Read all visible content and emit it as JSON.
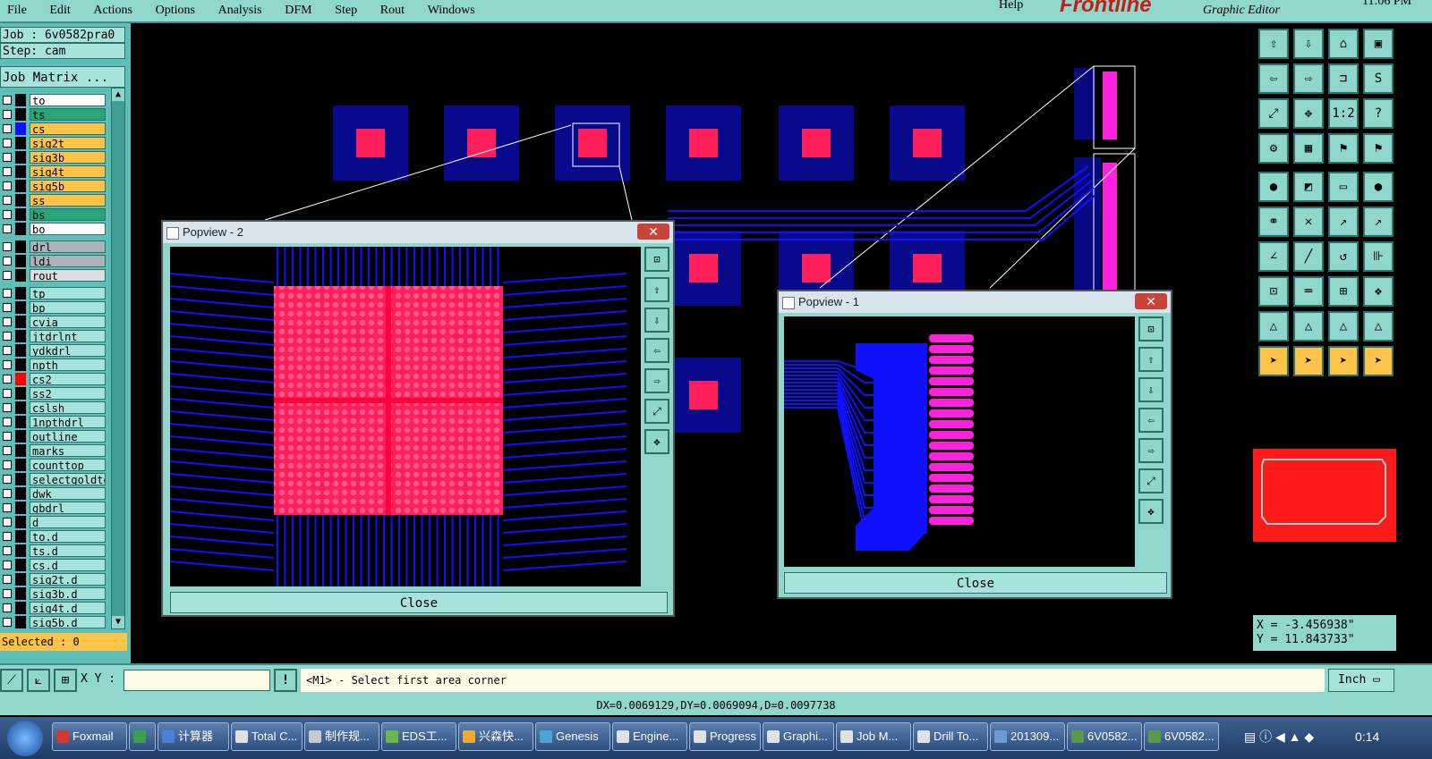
{
  "menubar": {
    "items": [
      "File",
      "Edit",
      "Actions",
      "Options",
      "Analysis",
      "DFM",
      "Step",
      "Rout",
      "Windows"
    ],
    "help": "Help"
  },
  "brand": {
    "logo": "Frontline",
    "subtitle": "Graphic Editor",
    "time": "11:06 PM"
  },
  "job": {
    "job": "Job : 6v0582pra0",
    "step": "Step: cam",
    "matrix_button": "Job Matrix ..."
  },
  "layers": [
    {
      "name": "to",
      "bg": "#ffffff",
      "sw": "#000000"
    },
    {
      "name": "ts",
      "bg": "#2aa579",
      "sw": "#000000"
    },
    {
      "name": "cs",
      "bg": "#ffc34a",
      "sw": "#1010ff"
    },
    {
      "name": "sig2t",
      "bg": "#ffc34a",
      "sw": "#000000"
    },
    {
      "name": "sig3b",
      "bg": "#ffc34a",
      "sw": "#000000"
    },
    {
      "name": "sig4t",
      "bg": "#ffc34a",
      "sw": "#000000"
    },
    {
      "name": "sig5b",
      "bg": "#ffc34a",
      "sw": "#000000"
    },
    {
      "name": "ss",
      "bg": "#ffc34a",
      "sw": "#000000"
    },
    {
      "name": "bs",
      "bg": "#2aa579",
      "sw": "#000000"
    },
    {
      "name": "bo",
      "bg": "#ffffff",
      "sw": "#000000"
    },
    {
      "name": "drl",
      "bg": "#a9b4b8",
      "sw": "#000000",
      "gap": true
    },
    {
      "name": "ldi",
      "bg": "#a9b4b8",
      "sw": "#000000"
    },
    {
      "name": "rout",
      "bg": "#d9dedf",
      "sw": "#000000"
    },
    {
      "name": "tp",
      "bg": "#a6e3dc",
      "sw": "#000000",
      "gap": true
    },
    {
      "name": "bp",
      "bg": "#a6e3dc",
      "sw": "#000000"
    },
    {
      "name": "cvia",
      "bg": "#a6e3dc",
      "sw": "#000000"
    },
    {
      "name": "jtdrlnt",
      "bg": "#a6e3dc",
      "sw": "#000000"
    },
    {
      "name": "ydkdrl",
      "bg": "#a6e3dc",
      "sw": "#000000"
    },
    {
      "name": "npth",
      "bg": "#a6e3dc",
      "sw": "#000000"
    },
    {
      "name": "cs2",
      "bg": "#a6e3dc",
      "sw": "#ff0000"
    },
    {
      "name": "ss2",
      "bg": "#a6e3dc",
      "sw": "#000000"
    },
    {
      "name": "cslsh",
      "bg": "#a6e3dc",
      "sw": "#000000"
    },
    {
      "name": "1npthdrl",
      "bg": "#a6e3dc",
      "sw": "#000000"
    },
    {
      "name": "outline",
      "bg": "#a6e3dc",
      "sw": "#000000"
    },
    {
      "name": "marks",
      "bg": "#a6e3dc",
      "sw": "#000000"
    },
    {
      "name": "counttop",
      "bg": "#a6e3dc",
      "sw": "#000000"
    },
    {
      "name": "selectgoldte",
      "bg": "#a6e3dc",
      "sw": "#000000"
    },
    {
      "name": "dwk",
      "bg": "#a6e3dc",
      "sw": "#000000"
    },
    {
      "name": "gbdrl",
      "bg": "#a6e3dc",
      "sw": "#000000"
    },
    {
      "name": "d",
      "bg": "#a6e3dc",
      "sw": "#000000"
    },
    {
      "name": "to.d",
      "bg": "#a6e3dc",
      "sw": "#000000"
    },
    {
      "name": "ts.d",
      "bg": "#a6e3dc",
      "sw": "#000000"
    },
    {
      "name": "cs.d",
      "bg": "#a6e3dc",
      "sw": "#000000"
    },
    {
      "name": "sig2t.d",
      "bg": "#a6e3dc",
      "sw": "#000000"
    },
    {
      "name": "sig3b.d",
      "bg": "#a6e3dc",
      "sw": "#000000"
    },
    {
      "name": "sig4t.d",
      "bg": "#a6e3dc",
      "sw": "#000000"
    },
    {
      "name": "sig5b.d",
      "bg": "#a6e3dc",
      "sw": "#000000"
    }
  ],
  "selected": "Selected : 0",
  "popview2": {
    "title": "Popview - 2",
    "close": "Close"
  },
  "popview1": {
    "title": "Popview - 1",
    "close": "Close"
  },
  "coords": {
    "x": "X = -3.456938\"",
    "y": "Y = 11.843733\""
  },
  "cmd": {
    "xy_label": "X Y :",
    "xy_value": "",
    "prompt": "<M1> - Select first area corner",
    "units": "Inch"
  },
  "status": {
    "dx": "DX=0.0069129,DY=0.0069094,D=0.0097738"
  },
  "taskbar": {
    "items": [
      "Foxmail",
      "",
      "计算器",
      "Total C...",
      "制作规...",
      "EDS工...",
      "兴森快...",
      "Genesis",
      "Engine...",
      "Progress",
      "Graphi...",
      "Job M...",
      "Drill To...",
      "201309...",
      "6V0582...",
      "6V0582..."
    ],
    "clock": "0:14"
  },
  "colors": {
    "accent": "#8fd6cd",
    "trace": "#1010ff",
    "pad": "#ff1f5a"
  }
}
